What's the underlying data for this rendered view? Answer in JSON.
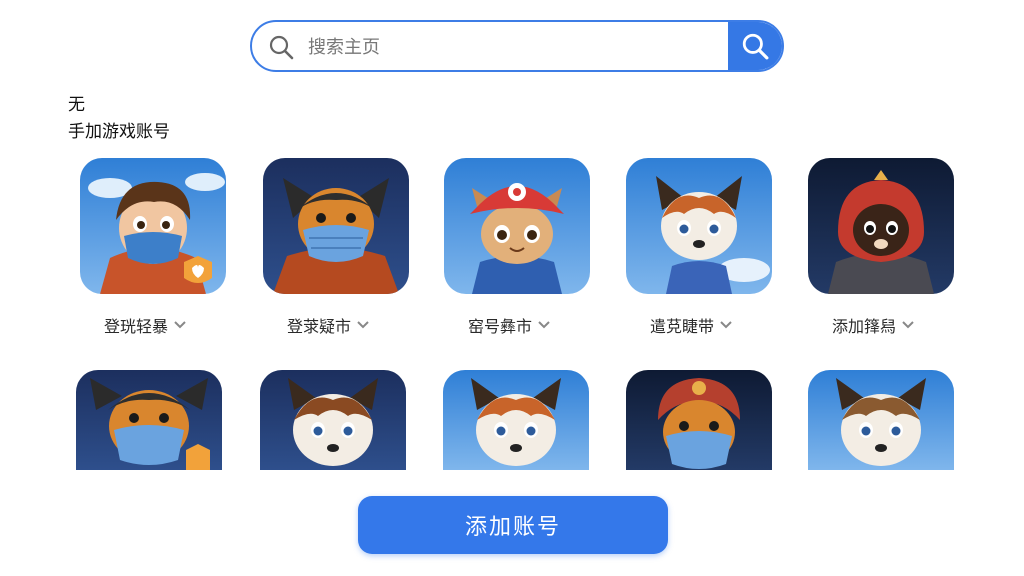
{
  "search": {
    "placeholder": "搜索主页"
  },
  "heading": {
    "line1": "无",
    "line2": "手加游戏账号"
  },
  "accounts_row1": [
    {
      "label": "登珖轻暴",
      "avatar": "boy-blue-mask-icon"
    },
    {
      "label": "登莍疑市",
      "avatar": "dog-blue-mask-icon"
    },
    {
      "label": "窑号彝市",
      "avatar": "cat-red-cap-icon"
    },
    {
      "label": "遣莌睫带",
      "avatar": "dog-husky-icon"
    },
    {
      "label": "添加箨舄",
      "avatar": "dog-red-hood-icon"
    }
  ],
  "accounts_row2": [
    {
      "avatar": "dog-blue-mask-icon"
    },
    {
      "avatar": "dog-husky-icon"
    },
    {
      "avatar": "dog-husky-icon"
    },
    {
      "avatar": "dog-blue-mask-icon"
    },
    {
      "avatar": "dog-husky-icon"
    }
  ],
  "add_button": {
    "label": "添加账号"
  },
  "colors": {
    "accent": "#3578e5",
    "button": "#3478ea"
  }
}
